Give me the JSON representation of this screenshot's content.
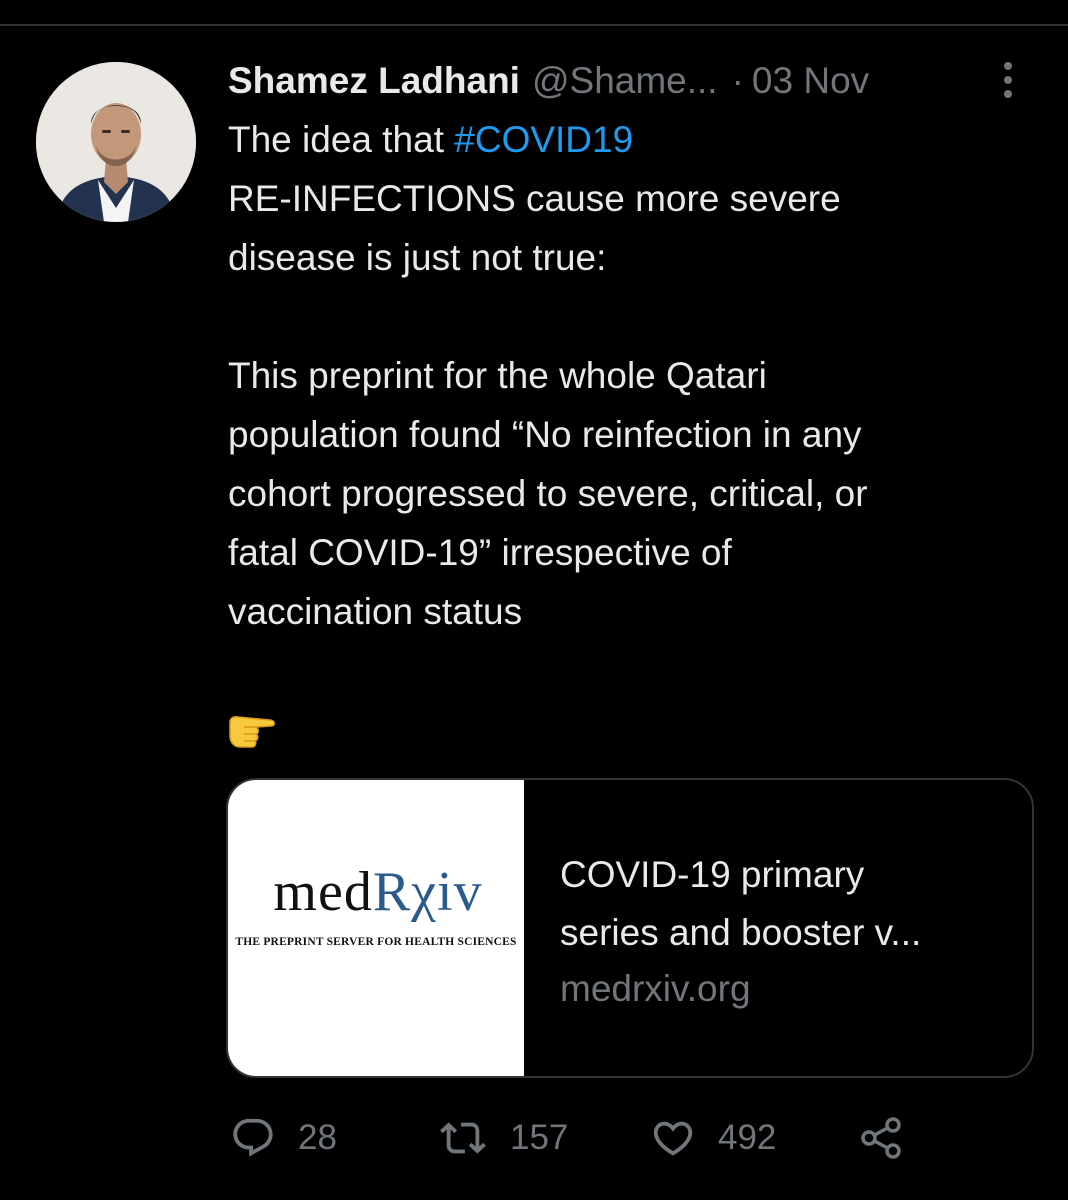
{
  "tweet": {
    "author_name": "Shamez Ladhani",
    "author_handle": "@Shame...",
    "separator": "·",
    "date": "03 Nov",
    "text_lines": [
      "RE-INFECTIONS cause more severe",
      "disease is just not true:",
      "",
      "This preprint for the whole Qatari",
      "population found “No reinfection in any",
      "cohort progressed to severe, critical, or",
      "fatal COVID-19” irrespective of",
      "vaccination status"
    ],
    "line1_prefix": "The idea that ",
    "hashtag": "#COVID19",
    "emoji_icon": "backhand-index-pointing-right-icon"
  },
  "card": {
    "logo_med": "med",
    "logo_r": "Rχiv",
    "logo_tagline": "THE PREPRINT SERVER FOR HEALTH SCIENCES",
    "title_line1": "COVID-19 primary",
    "title_line2": "series and booster v...",
    "domain": "medrxiv.org"
  },
  "actions": {
    "replies": "28",
    "retweets": "157",
    "likes": "492"
  },
  "colors": {
    "background": "#000000",
    "text": "#e7e9ea",
    "secondary": "#71767b",
    "link": "#1d9bf0",
    "border": "#2f3336"
  }
}
